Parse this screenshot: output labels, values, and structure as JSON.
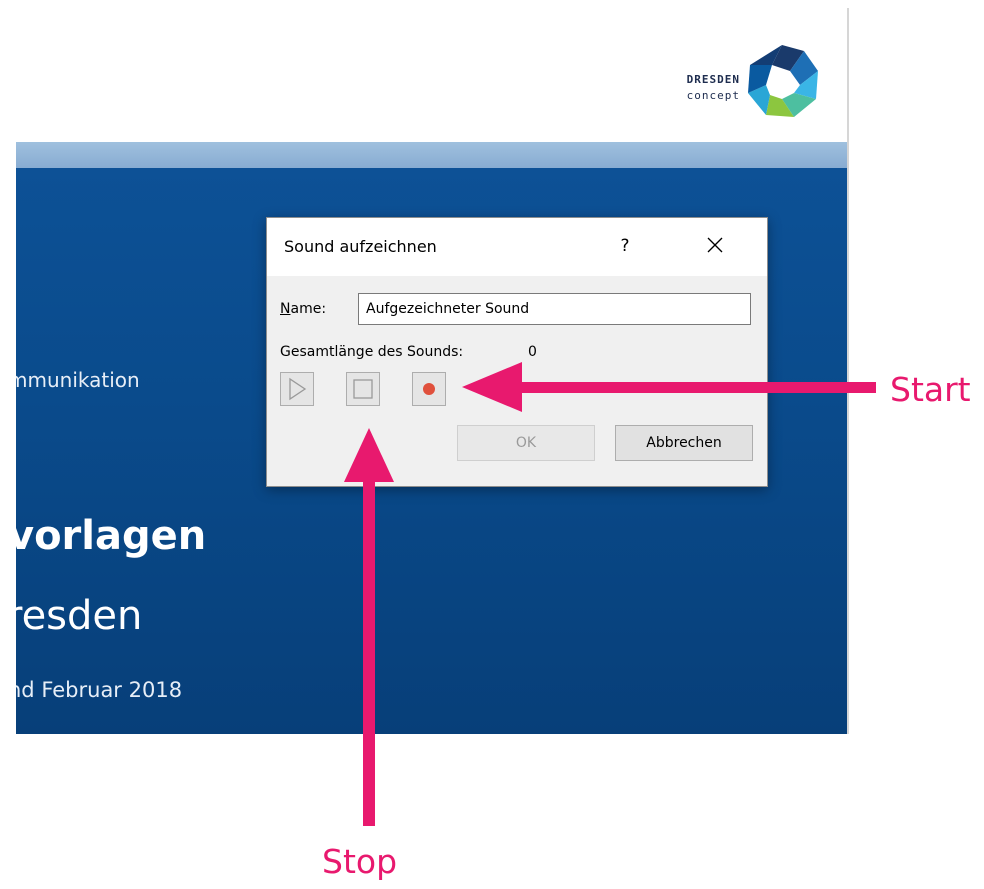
{
  "logo": {
    "line1": "DRESDEN",
    "line2": "concept",
    "icon": "hexagon-logo-icon",
    "colors": [
      "#1a3a6b",
      "#1e6fb5",
      "#3ab5e6",
      "#4dbfa0",
      "#8cc63f",
      "#0a5aa0"
    ]
  },
  "slide": {
    "subtitle_fragment": "mmunikation",
    "title_fragment": "vorlagen",
    "city_fragment": "resden",
    "date_fragment": "nd Februar 2018",
    "colors": {
      "background": "#0a4b8c",
      "stripe": "#9fc0de",
      "text": "#ffffff"
    }
  },
  "dialog": {
    "title": "Sound aufzeichnen",
    "help_label": "?",
    "close_icon": "close-icon",
    "name_label_mnemonic": "N",
    "name_label_rest": "ame:",
    "name_value": "Aufgezeichneter Sound",
    "length_label": "Gesamtlänge des Sounds:",
    "length_value": "0",
    "play_icon": "play-icon",
    "stop_icon": "stop-icon",
    "record_icon": "record-icon",
    "ok_label": "OK",
    "cancel_label": "Abbrechen",
    "ok_enabled": false,
    "colors": {
      "record": "#e0503c",
      "background": "#f0f0f0"
    }
  },
  "annotations": {
    "start_label": "Start",
    "stop_label": "Stop",
    "color": "#e8196e"
  }
}
